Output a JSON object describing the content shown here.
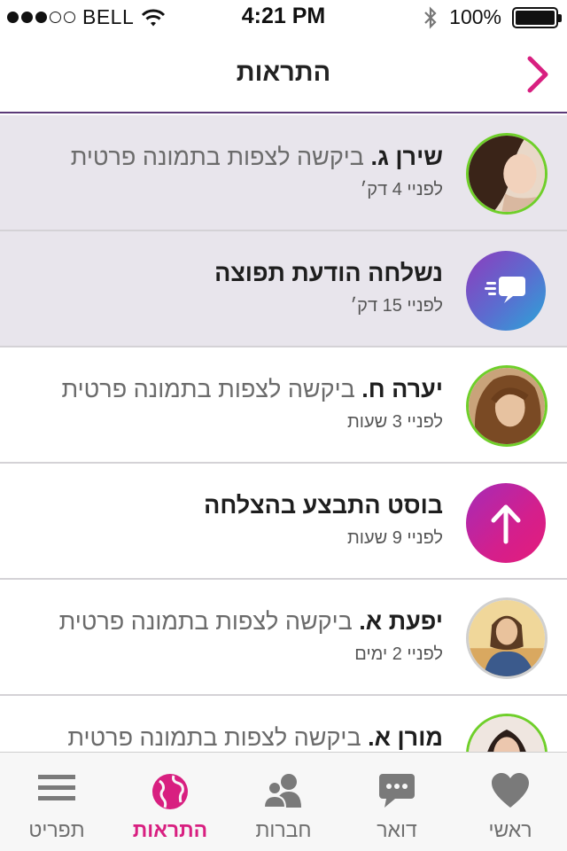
{
  "status_bar": {
    "carrier": "BELL",
    "time": "4:21 PM",
    "battery": "100%",
    "signal_strength": 3
  },
  "nav": {
    "title": "התראות",
    "back_icon": "chevron-right-icon"
  },
  "notifications": [
    {
      "name": "שירן ג.",
      "message": "ביקשה לצפות בתמונה פרטית",
      "time": "לפניי 4 דק׳",
      "unread": true,
      "avatar": "avatar-photo"
    },
    {
      "name": "",
      "message": "נשלחה הודעת תפוצה",
      "time": "לפניי 15 דק׳",
      "unread": true,
      "icon": "broadcast-message-icon"
    },
    {
      "name": "יערה ח.",
      "message": "ביקשה לצפות בתמונה פרטית",
      "time": "לפניי 3 שעות",
      "unread": false,
      "avatar": "avatar-photo"
    },
    {
      "name": "",
      "message": "בוסט התבצע בהצלחה",
      "time": "לפניי 9 שעות",
      "unread": false,
      "icon": "arrow-up-icon"
    },
    {
      "name": "יפעת א.",
      "message": "ביקשה לצפות בתמונה פרטית",
      "time": "לפניי 2 ימים",
      "unread": false,
      "avatar": "avatar-photo"
    },
    {
      "name": "מורן א.",
      "message": "ביקשה לצפות בתמונה פרטית",
      "time": "",
      "unread": false,
      "avatar": "avatar-photo"
    }
  ],
  "tabs": [
    {
      "label": "ראשי",
      "icon": "heart-icon",
      "active": false
    },
    {
      "label": "דואר",
      "icon": "chat-bubble-icon",
      "active": false
    },
    {
      "label": "חברות",
      "icon": "friends-icon",
      "active": false
    },
    {
      "label": "התראות",
      "icon": "globe-icon",
      "active": true
    },
    {
      "label": "תפריט",
      "icon": "menu-icon",
      "active": false
    }
  ],
  "colors": {
    "accent": "#d81f80",
    "online_ring": "#6fcf2a",
    "unread_row": "#e8e5ec",
    "nav_border": "#5b3a78"
  }
}
